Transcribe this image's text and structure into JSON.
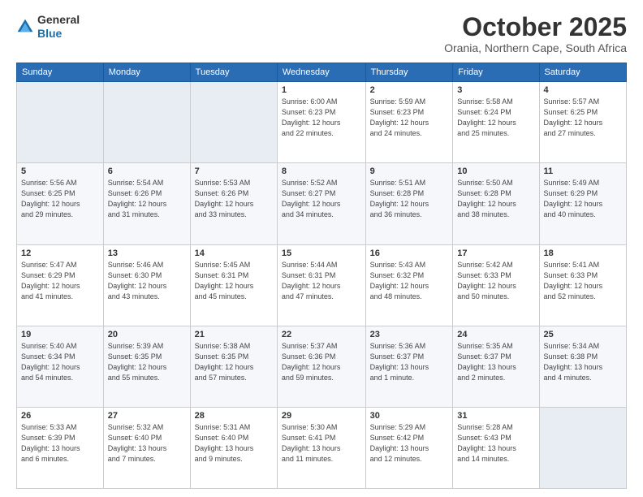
{
  "header": {
    "logo_general": "General",
    "logo_blue": "Blue",
    "month": "October 2025",
    "location": "Orania, Northern Cape, South Africa"
  },
  "weekdays": [
    "Sunday",
    "Monday",
    "Tuesday",
    "Wednesday",
    "Thursday",
    "Friday",
    "Saturday"
  ],
  "weeks": [
    [
      {
        "day": "",
        "info": ""
      },
      {
        "day": "",
        "info": ""
      },
      {
        "day": "",
        "info": ""
      },
      {
        "day": "1",
        "info": "Sunrise: 6:00 AM\nSunset: 6:23 PM\nDaylight: 12 hours\nand 22 minutes."
      },
      {
        "day": "2",
        "info": "Sunrise: 5:59 AM\nSunset: 6:23 PM\nDaylight: 12 hours\nand 24 minutes."
      },
      {
        "day": "3",
        "info": "Sunrise: 5:58 AM\nSunset: 6:24 PM\nDaylight: 12 hours\nand 25 minutes."
      },
      {
        "day": "4",
        "info": "Sunrise: 5:57 AM\nSunset: 6:25 PM\nDaylight: 12 hours\nand 27 minutes."
      }
    ],
    [
      {
        "day": "5",
        "info": "Sunrise: 5:56 AM\nSunset: 6:25 PM\nDaylight: 12 hours\nand 29 minutes."
      },
      {
        "day": "6",
        "info": "Sunrise: 5:54 AM\nSunset: 6:26 PM\nDaylight: 12 hours\nand 31 minutes."
      },
      {
        "day": "7",
        "info": "Sunrise: 5:53 AM\nSunset: 6:26 PM\nDaylight: 12 hours\nand 33 minutes."
      },
      {
        "day": "8",
        "info": "Sunrise: 5:52 AM\nSunset: 6:27 PM\nDaylight: 12 hours\nand 34 minutes."
      },
      {
        "day": "9",
        "info": "Sunrise: 5:51 AM\nSunset: 6:28 PM\nDaylight: 12 hours\nand 36 minutes."
      },
      {
        "day": "10",
        "info": "Sunrise: 5:50 AM\nSunset: 6:28 PM\nDaylight: 12 hours\nand 38 minutes."
      },
      {
        "day": "11",
        "info": "Sunrise: 5:49 AM\nSunset: 6:29 PM\nDaylight: 12 hours\nand 40 minutes."
      }
    ],
    [
      {
        "day": "12",
        "info": "Sunrise: 5:47 AM\nSunset: 6:29 PM\nDaylight: 12 hours\nand 41 minutes."
      },
      {
        "day": "13",
        "info": "Sunrise: 5:46 AM\nSunset: 6:30 PM\nDaylight: 12 hours\nand 43 minutes."
      },
      {
        "day": "14",
        "info": "Sunrise: 5:45 AM\nSunset: 6:31 PM\nDaylight: 12 hours\nand 45 minutes."
      },
      {
        "day": "15",
        "info": "Sunrise: 5:44 AM\nSunset: 6:31 PM\nDaylight: 12 hours\nand 47 minutes."
      },
      {
        "day": "16",
        "info": "Sunrise: 5:43 AM\nSunset: 6:32 PM\nDaylight: 12 hours\nand 48 minutes."
      },
      {
        "day": "17",
        "info": "Sunrise: 5:42 AM\nSunset: 6:33 PM\nDaylight: 12 hours\nand 50 minutes."
      },
      {
        "day": "18",
        "info": "Sunrise: 5:41 AM\nSunset: 6:33 PM\nDaylight: 12 hours\nand 52 minutes."
      }
    ],
    [
      {
        "day": "19",
        "info": "Sunrise: 5:40 AM\nSunset: 6:34 PM\nDaylight: 12 hours\nand 54 minutes."
      },
      {
        "day": "20",
        "info": "Sunrise: 5:39 AM\nSunset: 6:35 PM\nDaylight: 12 hours\nand 55 minutes."
      },
      {
        "day": "21",
        "info": "Sunrise: 5:38 AM\nSunset: 6:35 PM\nDaylight: 12 hours\nand 57 minutes."
      },
      {
        "day": "22",
        "info": "Sunrise: 5:37 AM\nSunset: 6:36 PM\nDaylight: 12 hours\nand 59 minutes."
      },
      {
        "day": "23",
        "info": "Sunrise: 5:36 AM\nSunset: 6:37 PM\nDaylight: 13 hours\nand 1 minute."
      },
      {
        "day": "24",
        "info": "Sunrise: 5:35 AM\nSunset: 6:37 PM\nDaylight: 13 hours\nand 2 minutes."
      },
      {
        "day": "25",
        "info": "Sunrise: 5:34 AM\nSunset: 6:38 PM\nDaylight: 13 hours\nand 4 minutes."
      }
    ],
    [
      {
        "day": "26",
        "info": "Sunrise: 5:33 AM\nSunset: 6:39 PM\nDaylight: 13 hours\nand 6 minutes."
      },
      {
        "day": "27",
        "info": "Sunrise: 5:32 AM\nSunset: 6:40 PM\nDaylight: 13 hours\nand 7 minutes."
      },
      {
        "day": "28",
        "info": "Sunrise: 5:31 AM\nSunset: 6:40 PM\nDaylight: 13 hours\nand 9 minutes."
      },
      {
        "day": "29",
        "info": "Sunrise: 5:30 AM\nSunset: 6:41 PM\nDaylight: 13 hours\nand 11 minutes."
      },
      {
        "day": "30",
        "info": "Sunrise: 5:29 AM\nSunset: 6:42 PM\nDaylight: 13 hours\nand 12 minutes."
      },
      {
        "day": "31",
        "info": "Sunrise: 5:28 AM\nSunset: 6:43 PM\nDaylight: 13 hours\nand 14 minutes."
      },
      {
        "day": "",
        "info": ""
      }
    ]
  ]
}
